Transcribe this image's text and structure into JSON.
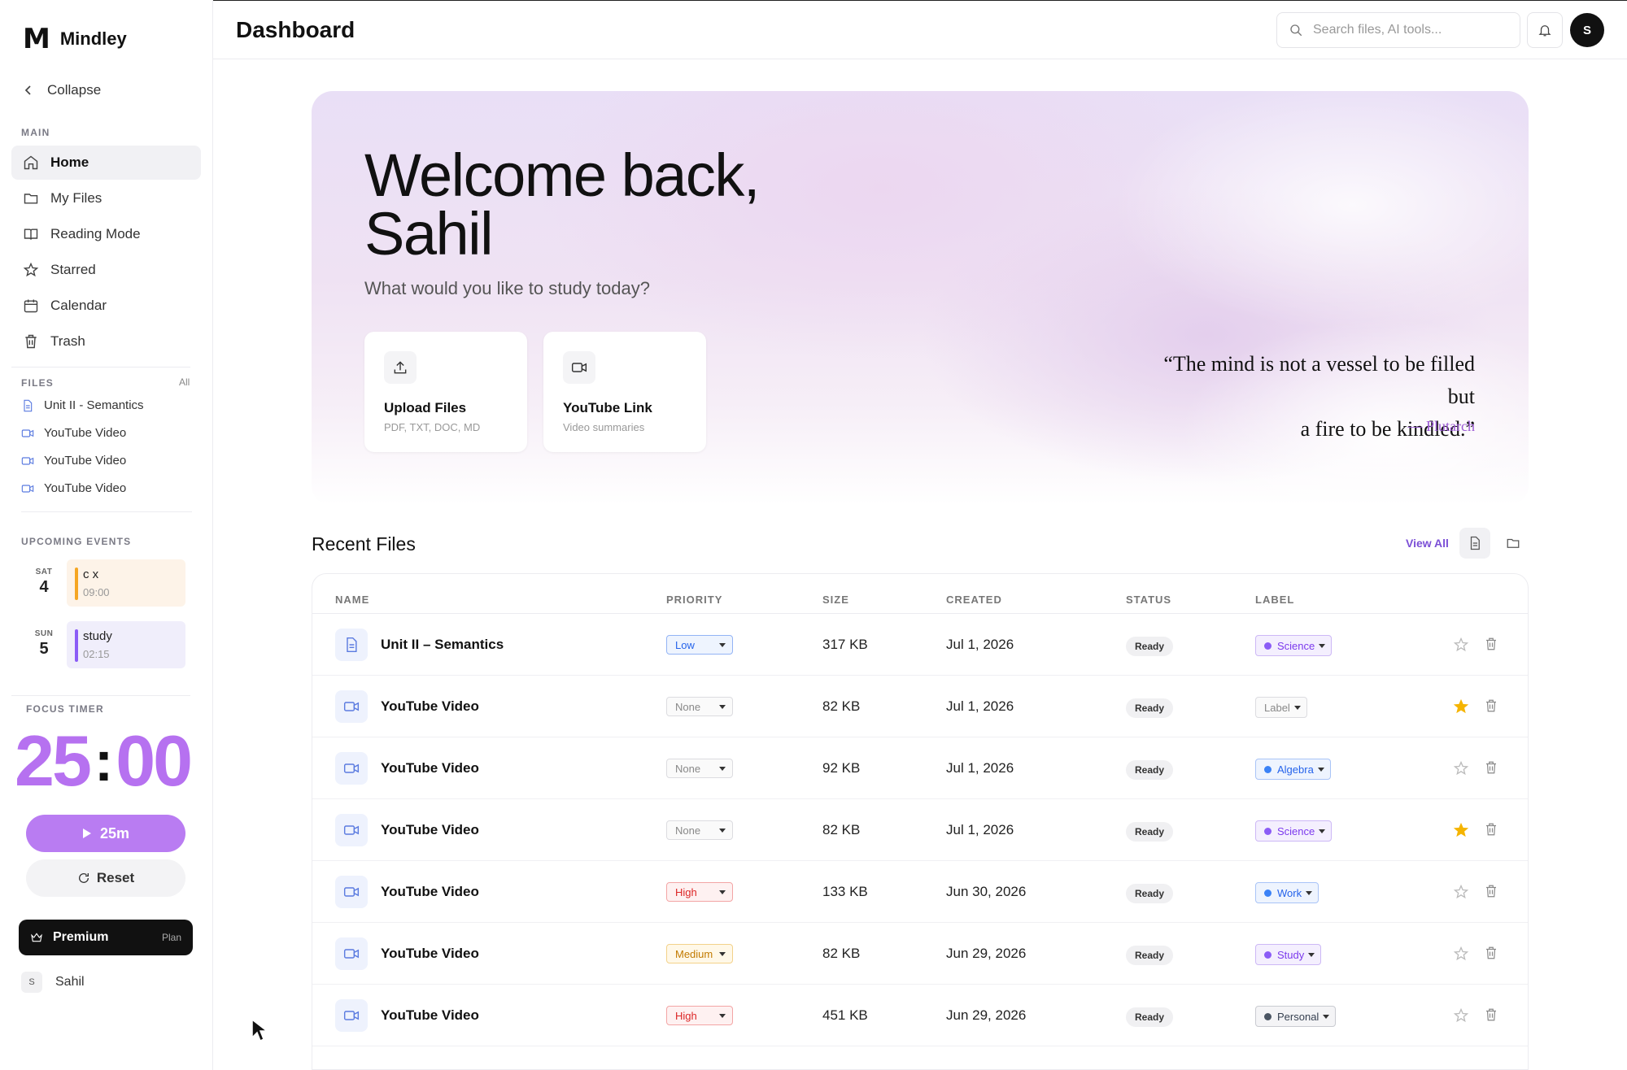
{
  "brand": {
    "mark": "M",
    "name": "Mindley"
  },
  "sidebar": {
    "collapse_label": "Collapse",
    "main_label": "MAIN",
    "nav": [
      {
        "label": "Home",
        "icon": "home-icon",
        "active": true
      },
      {
        "label": "My Files",
        "icon": "folder-icon"
      },
      {
        "label": "Reading Mode",
        "icon": "book-icon"
      },
      {
        "label": "Starred",
        "icon": "star-icon"
      },
      {
        "label": "Calendar",
        "icon": "calendar-icon"
      },
      {
        "label": "Trash",
        "icon": "trash-icon"
      }
    ],
    "files_label": "FILES",
    "files_all": "All",
    "files": [
      {
        "label": "Unit II - Semantics",
        "icon": "document-icon"
      },
      {
        "label": "YouTube Video",
        "icon": "video-icon"
      },
      {
        "label": "YouTube Video",
        "icon": "video-icon"
      },
      {
        "label": "YouTube Video",
        "icon": "video-icon"
      }
    ],
    "events_label": "UPCOMING EVENTS",
    "events": [
      {
        "dow": "SAT",
        "day": "4",
        "title": "c x",
        "time": "09:00",
        "color": "#f5a623",
        "bg": "#fdf3e8"
      },
      {
        "dow": "SUN",
        "day": "5",
        "title": "study",
        "time": "02:15",
        "color": "#8b5cf6",
        "bg": "#f0eefb"
      }
    ],
    "timer_label": "FOCUS TIMER",
    "timer_minutes": "25",
    "timer_colon": ":",
    "timer_seconds": "00",
    "start_label": "25m",
    "reset_label": "Reset",
    "premium_label": "Premium",
    "premium_plan": "Plan",
    "user_initial": "S",
    "user_name": "Sahil"
  },
  "header": {
    "title": "Dashboard",
    "search_placeholder": "Search files, AI tools...",
    "avatar_initial": "S"
  },
  "hero": {
    "title_line1": "Welcome back,",
    "title_line2": "Sahil",
    "subtitle": "What would you like to study today?",
    "actions": [
      {
        "title": "Upload Files",
        "subtitle": "PDF, TXT, DOC, MD",
        "icon": "upload-icon"
      },
      {
        "title": "YouTube Link",
        "subtitle": "Video summaries",
        "icon": "video-icon"
      }
    ],
    "quote_line1": "“The mind is not a vessel to be filled but",
    "quote_line2": "a fire to be kindled.”",
    "quote_author": "— Plutarch"
  },
  "recent": {
    "title": "Recent Files",
    "view_all": "View All",
    "columns": [
      "NAME",
      "PRIORITY",
      "SIZE",
      "CREATED",
      "STATUS",
      "LABEL"
    ],
    "rows": [
      {
        "name": "Unit II – Semantics",
        "type": "doc",
        "priority": "Low",
        "size": "317 KB",
        "created": "Jul 1, 2026",
        "status": "Ready",
        "label": "Science",
        "label_dot": "#8b5cf6",
        "starred": false
      },
      {
        "name": "YouTube Video",
        "type": "video",
        "priority": "None",
        "size": "82 KB",
        "created": "Jul 1, 2026",
        "status": "Ready",
        "label": "Label",
        "label_dot": "",
        "starred": true
      },
      {
        "name": "YouTube Video",
        "type": "video",
        "priority": "None",
        "size": "92 KB",
        "created": "Jul 1, 2026",
        "status": "Ready",
        "label": "Algebra",
        "label_dot": "#3b82f6",
        "starred": false
      },
      {
        "name": "YouTube Video",
        "type": "video",
        "priority": "None",
        "size": "82 KB",
        "created": "Jul 1, 2026",
        "status": "Ready",
        "label": "Science",
        "label_dot": "#8b5cf6",
        "starred": true
      },
      {
        "name": "YouTube Video",
        "type": "video",
        "priority": "High",
        "size": "133 KB",
        "created": "Jun 30, 2026",
        "status": "Ready",
        "label": "Work",
        "label_dot": "#3b82f6",
        "starred": false
      },
      {
        "name": "YouTube Video",
        "type": "video",
        "priority": "Medium",
        "size": "82 KB",
        "created": "Jun 29, 2026",
        "status": "Ready",
        "label": "Study",
        "label_dot": "#8b5cf6",
        "starred": false
      },
      {
        "name": "YouTube Video",
        "type": "video",
        "priority": "High",
        "size": "451 KB",
        "created": "Jun 29, 2026",
        "status": "Ready",
        "label": "Personal",
        "label_dot": "#4b5563",
        "starred": false
      }
    ]
  },
  "colors": {
    "accent": "#b671f0",
    "link": "#7b4fd6",
    "star": "#f5b400"
  }
}
